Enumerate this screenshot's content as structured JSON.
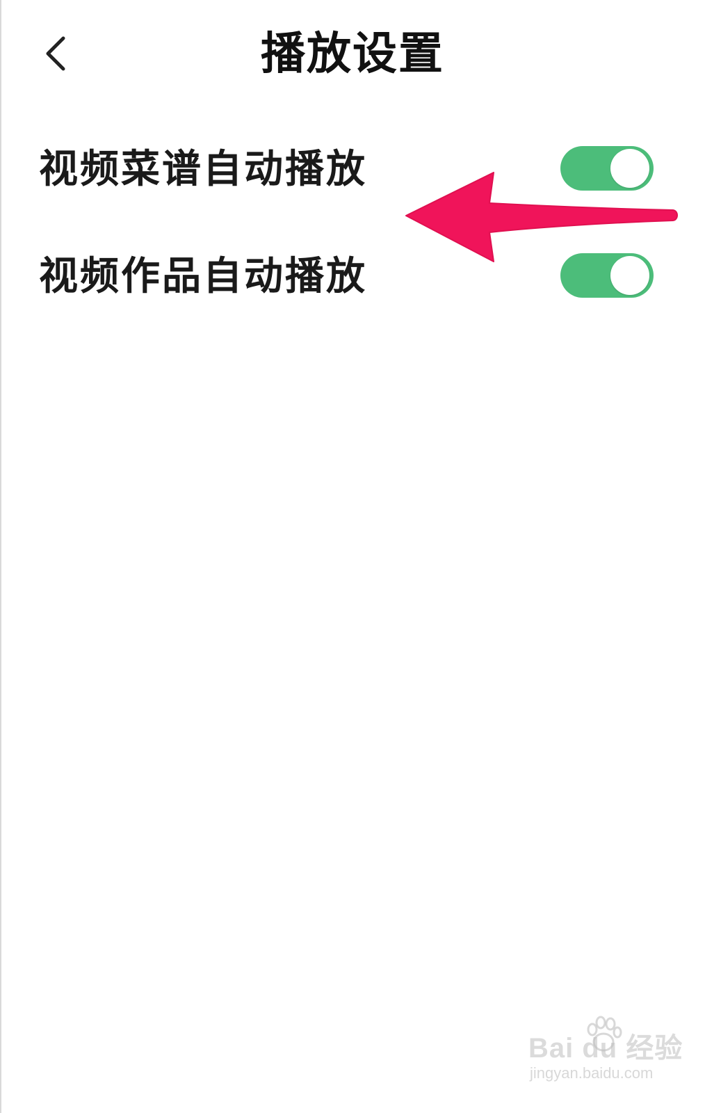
{
  "header": {
    "title": "播放设置",
    "back_icon": "chevron-left-icon"
  },
  "settings": [
    {
      "label": "视频菜谱自动播放",
      "enabled": true
    },
    {
      "label": "视频作品自动播放",
      "enabled": true
    }
  ],
  "colors": {
    "toggle_on": "#4cbd7a",
    "arrow": "#f0145a",
    "background": "#ffffff"
  },
  "watermark": {
    "brand": "Bai du 经验",
    "url": "jingyan.baidu.com"
  }
}
